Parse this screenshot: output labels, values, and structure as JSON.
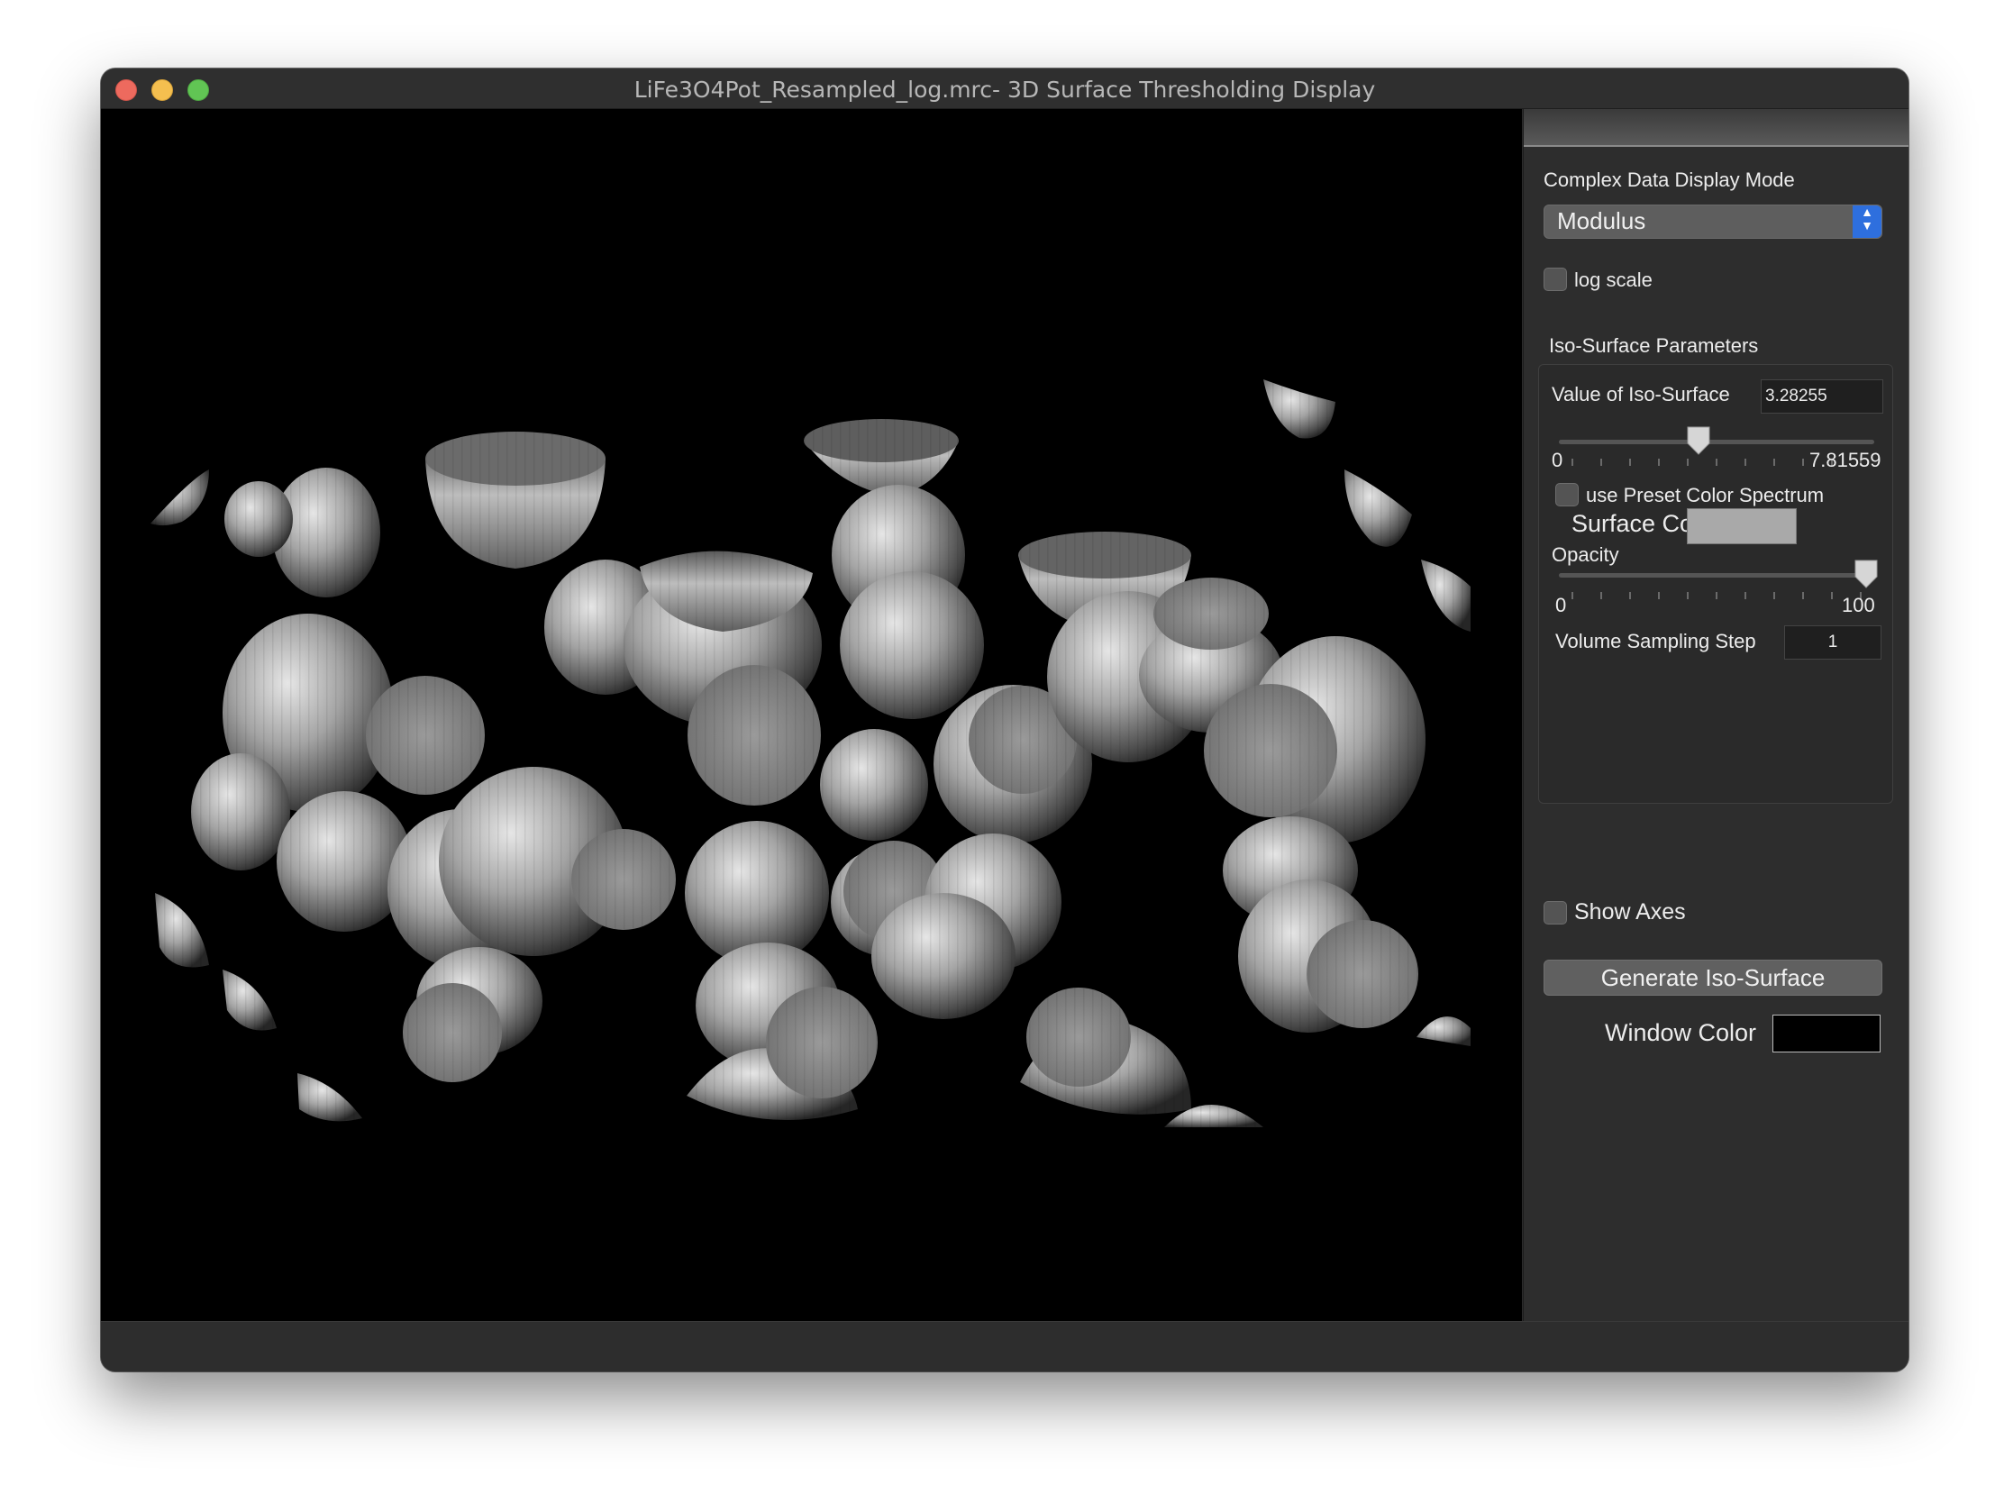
{
  "window": {
    "title": "LiFe3O4Pot_Resampled_log.mrc- 3D Surface Thresholding Display"
  },
  "panel": {
    "display_mode_label": "Complex Data Display Mode",
    "display_mode_value": "Modulus",
    "log_scale_label": "log scale",
    "log_scale_checked": false,
    "iso_group_label": "Iso-Surface Parameters",
    "iso_value_label": "Value of Iso-Surface",
    "iso_value": "3.28255",
    "iso_min": "0",
    "iso_max": "7.81559",
    "iso_slider_fraction": 0.42,
    "preset_label": "use Preset Color Spectrum",
    "preset_checked": false,
    "surface_color_label": "Surface Color",
    "surface_color": "#a9a9a9",
    "opacity_label": "Opacity",
    "opacity_min": "0",
    "opacity_max": "100",
    "opacity_value": 100,
    "sampling_label": "Volume Sampling Step",
    "sampling_value": "1",
    "show_axes_label": "Show  Axes",
    "show_axes_checked": false,
    "generate_label": "Generate Iso-Surface",
    "window_color_label": "Window Color",
    "window_color": "#000000"
  },
  "colors": {
    "accent": "#2e6fde",
    "viewport_background": "#000000"
  }
}
